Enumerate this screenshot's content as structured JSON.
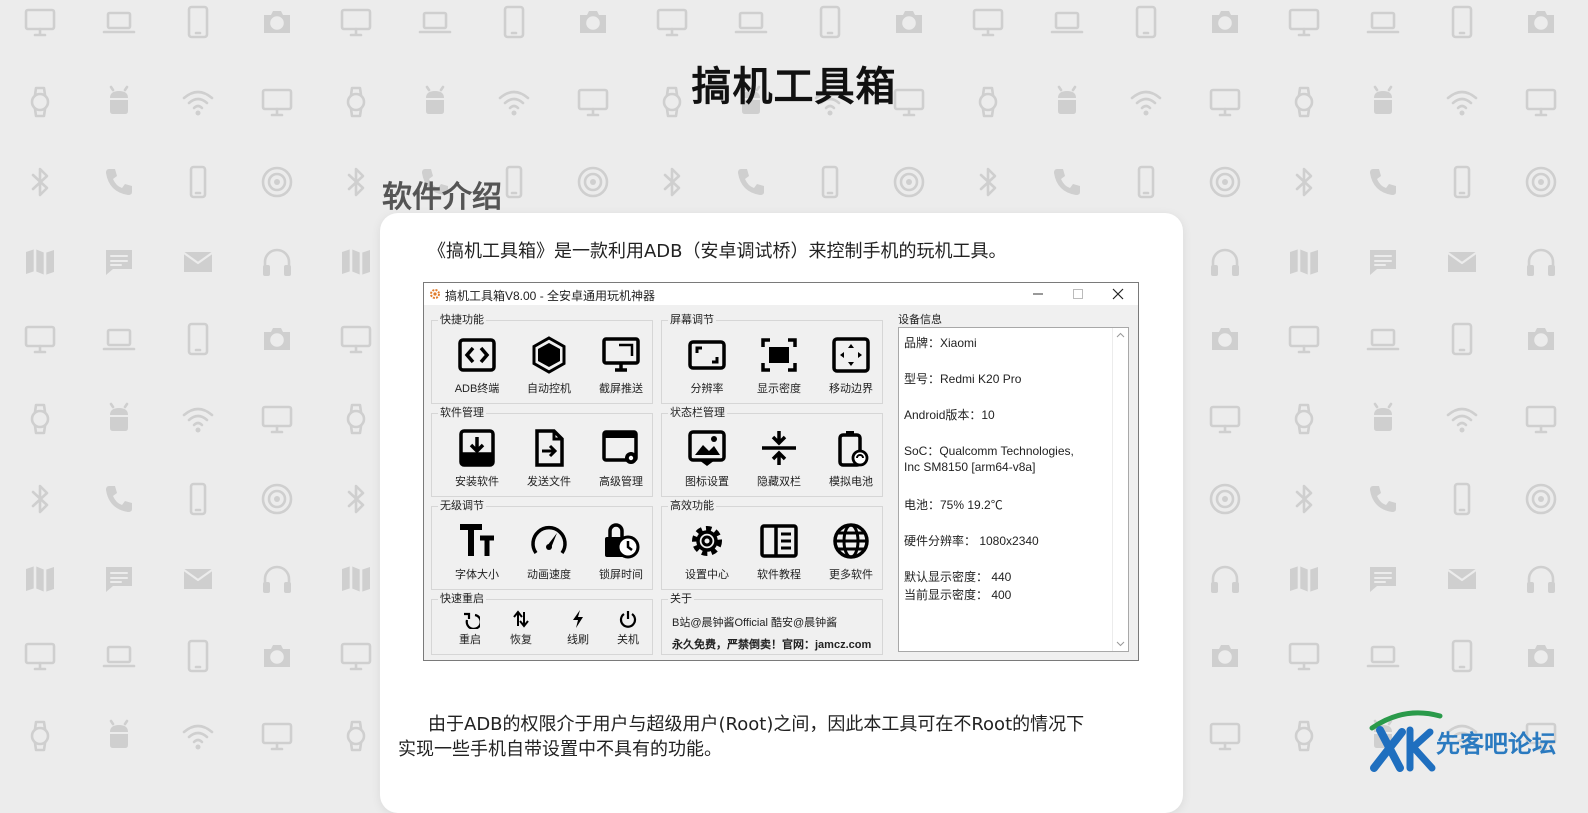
{
  "page": {
    "title": "搞机工具箱",
    "section_title": "软件介绍",
    "intro": "《搞机工具箱》是一款利用ADB（安卓调试桥）来控制手机的玩机工具。",
    "body_line1": "由于ADB的权限介于用户与超级用户(Root)之间，因此本工具可在不Root的情况下",
    "body_line2": "实现一些手机自带设置中不具有的功能。"
  },
  "app_window": {
    "title": "搞机工具箱V8.00 - 全安卓通用玩机神器",
    "groups": [
      {
        "label": "快捷功能",
        "items": [
          {
            "label": "ADB终端",
            "icon": "code-icon"
          },
          {
            "label": "自动控机",
            "icon": "hexagon-icon"
          },
          {
            "label": "截屏推送",
            "icon": "monitor-icon"
          }
        ]
      },
      {
        "label": "屏幕调节",
        "items": [
          {
            "label": "分辨率",
            "icon": "resolution-icon"
          },
          {
            "label": "显示密度",
            "icon": "density-icon"
          },
          {
            "label": "移动边界",
            "icon": "border-icon"
          }
        ]
      },
      {
        "label": "软件管理",
        "items": [
          {
            "label": "安装软件",
            "icon": "install-icon"
          },
          {
            "label": "发送文件",
            "icon": "send-file-icon"
          },
          {
            "label": "高级管理",
            "icon": "window-settings-icon"
          }
        ]
      },
      {
        "label": "状态栏管理",
        "items": [
          {
            "label": "图标设置",
            "icon": "image-icon"
          },
          {
            "label": "隐藏双栏",
            "icon": "collapse-icon"
          },
          {
            "label": "模拟电池",
            "icon": "battery-icon"
          }
        ]
      },
      {
        "label": "无级调节",
        "items": [
          {
            "label": "字体大小",
            "icon": "font-size-icon"
          },
          {
            "label": "动画速度",
            "icon": "speedometer-icon"
          },
          {
            "label": "锁屏时间",
            "icon": "lock-clock-icon"
          }
        ]
      },
      {
        "label": "高效功能",
        "items": [
          {
            "label": "设置中心",
            "icon": "gear-icon"
          },
          {
            "label": "软件教程",
            "icon": "book-icon"
          },
          {
            "label": "更多软件",
            "icon": "globe-icon"
          }
        ]
      }
    ],
    "quick_reboot": {
      "label": "快速重启",
      "items": [
        {
          "label": "重启",
          "icon": "restart-icon"
        },
        {
          "label": "恢复",
          "icon": "recovery-icon"
        },
        {
          "label": "线刷",
          "icon": "flash-icon"
        },
        {
          "label": "关机",
          "icon": "power-icon"
        }
      ]
    },
    "about": {
      "label": "关于",
      "line1": "B站@晨钟酱Official  酷安@晨钟酱",
      "line2": "永久免费，严禁倒卖！官网：jamcz.com"
    },
    "device_info": {
      "label": "设备信息",
      "brand": "品牌：Xiaomi",
      "model": "型号：Redmi K20 Pro",
      "android": "Android版本：10",
      "soc_line1": "SoC：Qualcomm Technologies,",
      "soc_line2": "Inc SM8150 [arm64-v8a]",
      "battery": "电池：75%  19.2℃",
      "hw_resolution": "硬件分辨率：  1080x2340",
      "default_density": "默认显示密度：  440",
      "current_density": "当前显示密度：  400"
    }
  },
  "watermark": {
    "text": "先客吧论坛",
    "logo_letters": "XK"
  },
  "colors": {
    "background": "#ececec",
    "pattern": "#cfcfcf",
    "card": "#ffffff",
    "watermark_green": "#2a9a4a",
    "watermark_blue": "#1f6fbf"
  }
}
